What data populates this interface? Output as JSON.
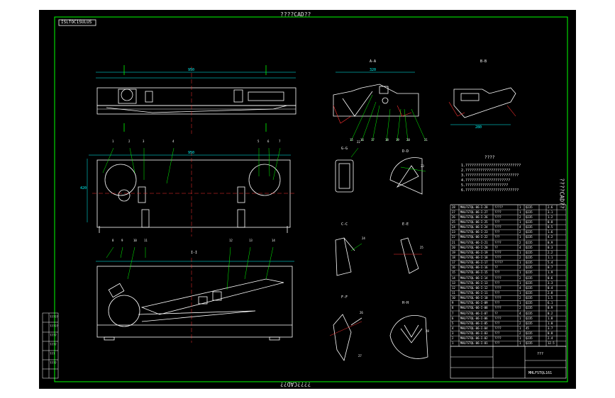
{
  "colors": {
    "background": "#000000",
    "frame": "#00ff00",
    "dims": "#00ffff",
    "center": "#ff3030",
    "text": "#ffffff",
    "cad": "#e0e0e0"
  },
  "title_top": "????CAD??",
  "title_bottom": "????CAD??",
  "right_side_text": "????CAD??",
  "drawing_code": "ISLTOC1SULUS",
  "view_labels": {
    "aa": "A-A",
    "bb": "B-B",
    "cc": "C-C",
    "dd": "D-D",
    "ee": "E-E",
    "ff": "F-F",
    "gg": "G-G",
    "hh": "H-H",
    "main": "I-I",
    "scale": "1:2"
  },
  "tech_title": "????",
  "tech_notes": [
    "1.??????????????????????????",
    "2.?????????????????????",
    "3.?????????????????????????",
    "4.?????????????????????",
    "5.????????????????????",
    "6.?????????????????????????"
  ],
  "title_block": {
    "project": "???",
    "drawing_no": "MHLFSTQL161"
  },
  "bom_rows": [
    {
      "no": "28",
      "code": "MHLFSTQL-06-I-28",
      "name": "?????",
      "qty": "1",
      "mat": "Q235",
      "note": "2.6"
    },
    {
      "no": "27",
      "code": "MHLFSTQL-06-I-27",
      "name": "????",
      "qty": "1",
      "mat": "Q235",
      "note": "3.1"
    },
    {
      "no": "26",
      "code": "MHLFSTQL-06-I-26",
      "name": "????",
      "qty": "2",
      "mat": "Q235",
      "note": "1.2"
    },
    {
      "no": "25",
      "code": "MHLFSTQL-06-I-25",
      "name": "???",
      "qty": "1",
      "mat": "Q235",
      "note": "0.8"
    },
    {
      "no": "24",
      "code": "MHLFSTQL-06-I-24",
      "name": "????",
      "qty": "4",
      "mat": "Q235",
      "note": "0.5"
    },
    {
      "no": "23",
      "code": "MHLFSTQL-06-I-23",
      "name": "???",
      "qty": "2",
      "mat": "Q235",
      "note": "1.6"
    },
    {
      "no": "22",
      "code": "MHLFSTQL-06-I-22",
      "name": "???",
      "qty": "1",
      "mat": "Q235",
      "note": "4.2"
    },
    {
      "no": "21",
      "code": "MHLFSTQL-06-I-21",
      "name": "????",
      "qty": "2",
      "mat": "Q235",
      "note": "0.9"
    },
    {
      "no": "20",
      "code": "MHLFSTQL-06-I-20",
      "name": "??",
      "qty": "4",
      "mat": "Q235",
      "note": "0.3"
    },
    {
      "no": "19",
      "code": "MHLFSTQL-06-I-19",
      "name": "????",
      "qty": "1",
      "mat": "Q235",
      "note": "2.2"
    },
    {
      "no": "18",
      "code": "MHLFSTQL-06-I-18",
      "name": "????",
      "qty": "2",
      "mat": "Q235",
      "note": "1.1"
    },
    {
      "no": "17",
      "code": "MHLFSTQL-06-I-17",
      "name": "?????",
      "qty": "1",
      "mat": "Q235",
      "note": "5.4"
    },
    {
      "no": "16",
      "code": "MHLFSTQL-06-I-16",
      "name": "??",
      "qty": "2",
      "mat": "Q235",
      "note": "0.7"
    },
    {
      "no": "15",
      "code": "MHLFSTQL-06-I-15",
      "name": "???",
      "qty": "1",
      "mat": "Q235",
      "note": "1.9"
    },
    {
      "no": "14",
      "code": "MHLFSTQL-06-I-14",
      "name": "????",
      "qty": "2",
      "mat": "Q235",
      "note": "0.6"
    },
    {
      "no": "13",
      "code": "MHLFSTQL-06-I-13",
      "name": "???",
      "qty": "1",
      "mat": "Q235",
      "note": "3.3"
    },
    {
      "no": "12",
      "code": "MHLFSTQL-06-I-12",
      "name": "????",
      "qty": "4",
      "mat": "Q235",
      "note": "0.4"
    },
    {
      "no": "11",
      "code": "MHLFSTQL-06-I-11",
      "name": "???",
      "qty": "1",
      "mat": "Q235",
      "note": "2.8"
    },
    {
      "no": "10",
      "code": "MHLFSTQL-06-I-10",
      "name": "????",
      "qty": "2",
      "mat": "Q235",
      "note": "1.5"
    },
    {
      "no": "9",
      "code": "MHLFSTQL-06-I-09",
      "name": "???",
      "qty": "1",
      "mat": "Q235",
      "note": "6.1"
    },
    {
      "no": "8",
      "code": "MHLFSTQL-06-I-08",
      "name": "????",
      "qty": "2",
      "mat": "Q235",
      "note": "0.9"
    },
    {
      "no": "7",
      "code": "MHLFSTQL-06-I-07",
      "name": "??",
      "qty": "4",
      "mat": "Q235",
      "note": "0.2"
    },
    {
      "no": "6",
      "code": "MHLFSTQL-06-I-06",
      "name": "????",
      "qty": "1",
      "mat": "Q235",
      "note": "1.8"
    },
    {
      "no": "5",
      "code": "MHLFSTQL-06-I-05",
      "name": "???",
      "qty": "2",
      "mat": "Q235",
      "note": "1.0"
    },
    {
      "no": "4",
      "code": "MHLFSTQL-06-I-04",
      "name": "????",
      "qty": "1",
      "mat": "45",
      "note": "3.7"
    },
    {
      "no": "3",
      "code": "MHLFSTQL-06-I-03",
      "name": "???",
      "qty": "2",
      "mat": "Q235",
      "note": "0.8"
    },
    {
      "no": "2",
      "code": "MHLFSTQL-06-I-02",
      "name": "????",
      "qty": "1",
      "mat": "Q235",
      "note": "2.4"
    },
    {
      "no": "1",
      "code": "MHLFSTQL-06-I-01",
      "name": "???",
      "qty": "1",
      "mat": "Q235",
      "note": "12.5"
    }
  ],
  "left_table_rows": [
    "?????",
    "?????",
    "????",
    "????",
    "???",
    "????"
  ],
  "balloons": [
    "1",
    "2",
    "3",
    "4",
    "5",
    "6",
    "7",
    "8",
    "9",
    "10",
    "11",
    "12",
    "13",
    "14",
    "15",
    "16",
    "17",
    "18",
    "19",
    "20",
    "21",
    "22",
    "23",
    "24",
    "25",
    "26",
    "27",
    "28"
  ],
  "dims": {
    "overall_length": "950",
    "width": "420",
    "height": "180",
    "aa_width": "320",
    "bb_width": "280"
  }
}
